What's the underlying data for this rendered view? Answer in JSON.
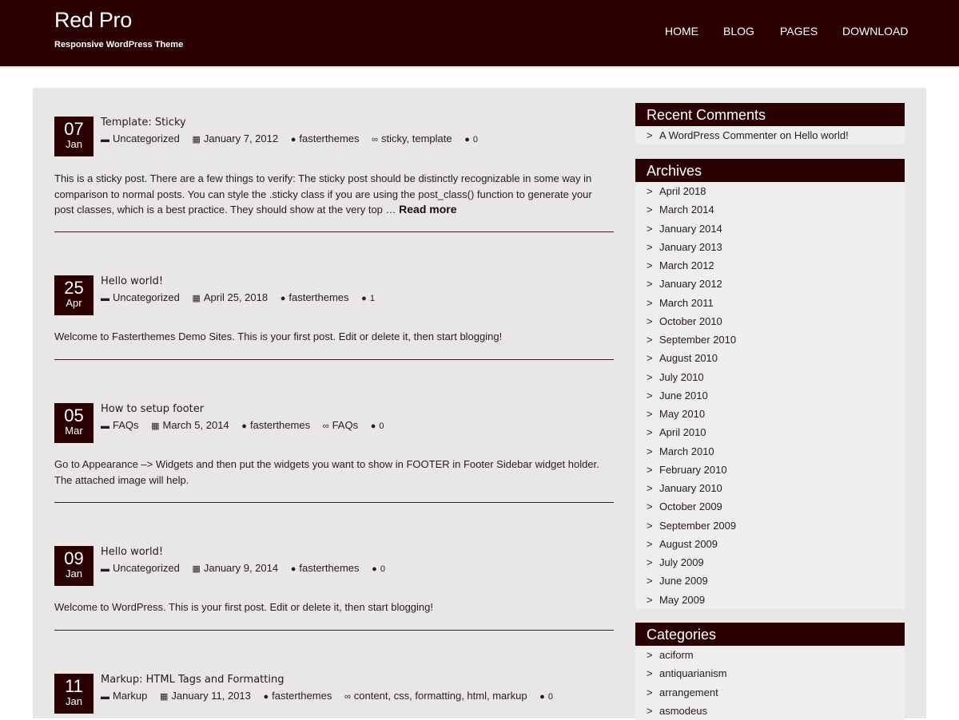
{
  "site": {
    "title": "Red Pro",
    "tagline": "Responsive WordPress Theme"
  },
  "nav": [
    "HOME",
    "BLOG",
    "PAGES",
    "DOWNLOAD"
  ],
  "posts": [
    {
      "day": "07",
      "month": "Jan",
      "title": "Template: Sticky",
      "category": "Uncategorized",
      "date": "January 7, 2012",
      "author": "fasterthemes",
      "tags": "sticky, template",
      "comments": "0",
      "excerpt": "This is a sticky post. There are a few things to verify: The sticky post should be distinctly recognizable in some way in comparison to normal posts. You can style the .sticky class if you are using the post_class() function to generate your post classes, which is a best practice. They should show at the very top …",
      "read_more": "Read more"
    },
    {
      "day": "25",
      "month": "Apr",
      "title": "Hello world!",
      "category": "Uncategorized",
      "date": "April 25, 2018",
      "author": "fasterthemes",
      "comments": "1",
      "excerpt": "Welcome to Fasterthemes Demo Sites. This is your first post. Edit or delete it, then start blogging!"
    },
    {
      "day": "05",
      "month": "Mar",
      "title": "How to setup footer",
      "category": "FAQs",
      "date": "March 5, 2014",
      "author": "fasterthemes",
      "tags": "FAQs",
      "comments": "0",
      "excerpt": "Go to Appearance –> Widgets and then put the widgets you want to show in FOOTER  in Footer Sidebar widget holder. The attached image will help."
    },
    {
      "day": "09",
      "month": "Jan",
      "title": "Hello world!",
      "category": "Uncategorized",
      "date": "January 9, 2014",
      "author": "fasterthemes",
      "comments": "0",
      "excerpt": "Welcome to WordPress. This is your first post. Edit or delete it, then start blogging!"
    },
    {
      "day": "11",
      "month": "Jan",
      "title": "Markup: HTML Tags and Formatting",
      "category": "Markup",
      "date": "January 11, 2013",
      "author": "fasterthemes",
      "tags": "content, css, formatting, html, markup",
      "comments": "0"
    }
  ],
  "sidebar": {
    "recent_comments": {
      "title": "Recent Comments",
      "items": [
        "A WordPress Commenter on Hello world!"
      ]
    },
    "archives": {
      "title": "Archives",
      "items": [
        "April 2018",
        "March 2014",
        "January 2014",
        "January 2013",
        "March 2012",
        "January 2012",
        "March 2011",
        "October 2010",
        "September 2010",
        "August 2010",
        "July 2010",
        "June 2010",
        "May 2010",
        "April 2010",
        "March 2010",
        "February 2010",
        "January 2010",
        "October 2009",
        "September 2009",
        "August 2009",
        "July 2009",
        "June 2009",
        "May 2009"
      ]
    },
    "categories": {
      "title": "Categories",
      "items": [
        "aciform",
        "antiquarianism",
        "arrangement",
        "asmodeus"
      ]
    }
  },
  "icons": {
    "list_arrow": ">",
    "category": "folder-icon",
    "date": "calendar-icon",
    "author": "user-icon",
    "tags": "tag-icon",
    "comments": "comment-icon"
  },
  "colors": {
    "brand": "#2b0000",
    "content_bg": "#e8e6e6",
    "widget_bg": "#eeeeee"
  }
}
